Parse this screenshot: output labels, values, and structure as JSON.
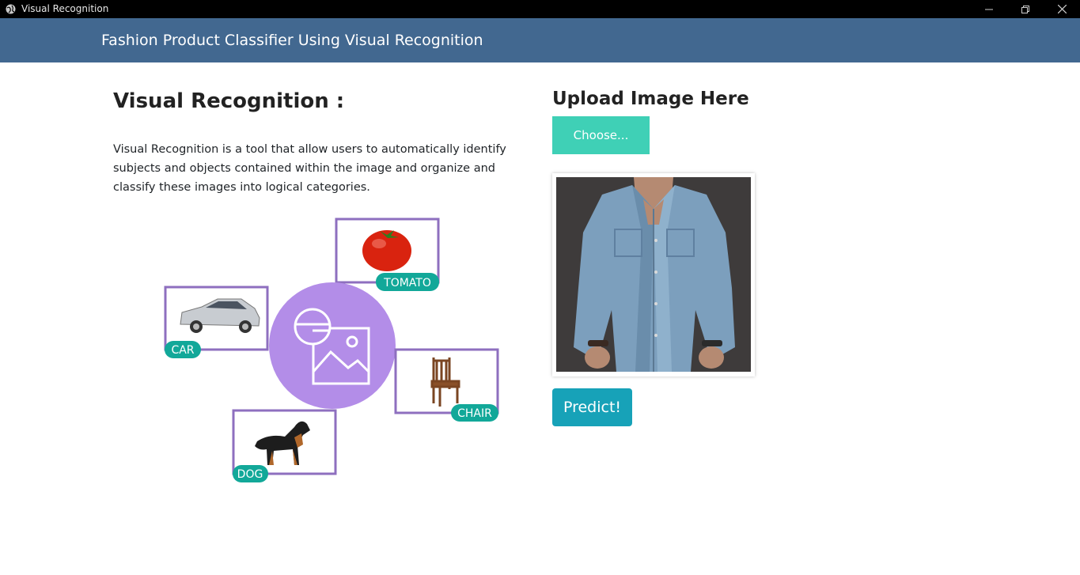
{
  "window": {
    "title": "Visual Recognition",
    "icon": "globe-icon",
    "controls": [
      "minimize-icon",
      "restore-icon",
      "close-icon"
    ]
  },
  "navbar": {
    "brand": "Fashion Product Classifier Using Visual Recognition",
    "color": "#426890"
  },
  "intro": {
    "heading": "Visual Recognition :",
    "description": "Visual Recognition is a tool that allow users to automatically identify subjects and objects contained within the image and organize and classify these images into logical categories."
  },
  "illustration": {
    "labels": {
      "tomato": "TOMATO",
      "car": "CAR",
      "chair": "CHAIR",
      "dog": "DOG"
    },
    "center_icon": "image-recognition-icon",
    "frame_color": "#8e6fbf",
    "label_color": "#12a899",
    "circle_color": "#b38de8"
  },
  "upload": {
    "heading": "Upload Image Here",
    "choose_label": "Choose...",
    "choose_color": "#3fd0b6",
    "preview_image": "denim-shirt-photo"
  },
  "predict": {
    "label": "Predict!",
    "color": "#17a2b8"
  }
}
